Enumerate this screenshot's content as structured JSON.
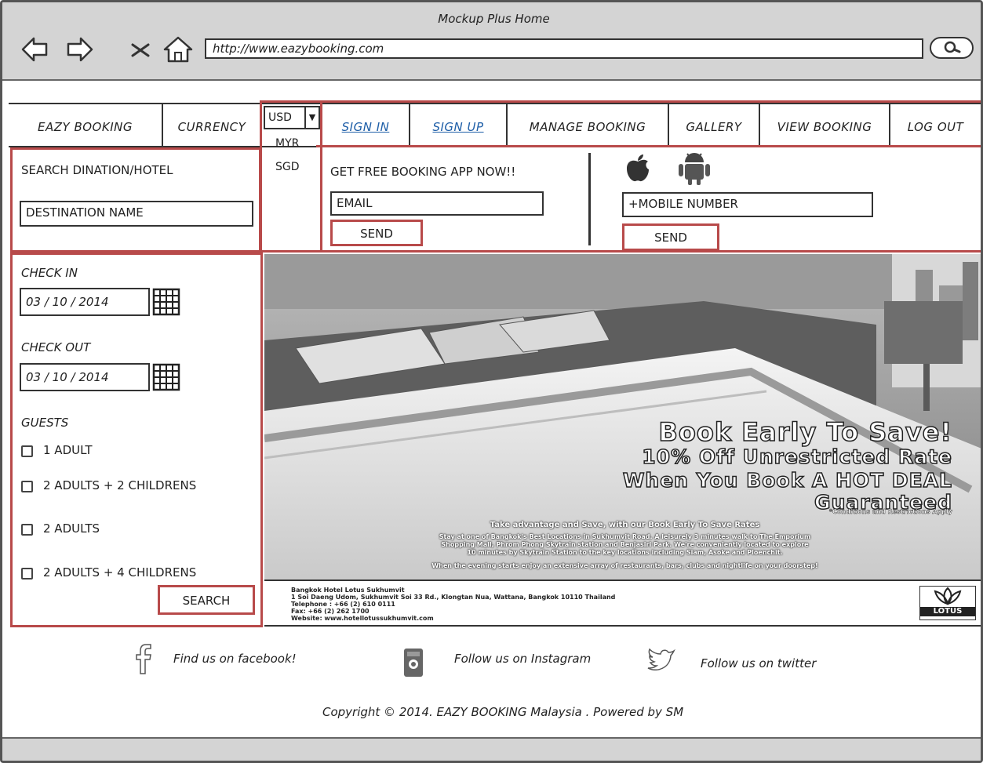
{
  "window": {
    "title": "Mockup Plus Home",
    "url": "http://www.eazybooking.com"
  },
  "nav": {
    "brand": "EAZY BOOKING",
    "currency_label": "CURRENCY",
    "currency_selected": "USD",
    "currency_options": [
      "MYR",
      "SGD"
    ],
    "sign_in": "SIGN IN",
    "sign_up": "SIGN UP",
    "manage_booking": "MANAGE BOOKING",
    "gallery": "GALLERY",
    "view_booking": "VIEW BOOKING",
    "log_out": "LOG OUT"
  },
  "search": {
    "title": "SEARCH DINATION/HOTEL",
    "destination_placeholder": "DESTINATION NAME",
    "check_in_label": "CHECK IN",
    "check_in_value": "03 / 10 / 2014",
    "check_out_label": "CHECK OUT",
    "check_out_value": "03 / 10 / 2014",
    "guests_label": "GUESTS",
    "guest_options": [
      "1 ADULT",
      "2 ADULTS + 2 CHILDRENS",
      "2 ADULTS",
      "2 ADULTS + 4 CHILDRENS"
    ],
    "search_button": "SEARCH"
  },
  "app_promo": {
    "title": "GET FREE BOOKING APP NOW!!",
    "email_placeholder": "EMAIL",
    "email_send": "SEND",
    "mobile_placeholder": "+MOBILE NUMBER",
    "mobile_send": "SEND"
  },
  "hero": {
    "line1": "Book Early To Save!",
    "line2": "10% Off Unrestricted Rate",
    "line3": "When You Book A HOT DEAL",
    "line4": "Guaranteed",
    "conditions": "*Conditions and Restrictions Apply",
    "subhead": "Take advantage and Save, with our Book Early To Save Rates",
    "body1": "Stay at one of Bangkok's Best Locations in Sukhumvit Road. A leisurely 3 minutes walk to The Emporium",
    "body2": "Shopping Mall, Phrom Phong Skytrain station and Benjasiri Park. We're conveniently located to explore",
    "body3": "10 minutes by Skytrain Station to the key locations including Siam, Asoke and Ploenchit.",
    "body4": "When the evening starts enjoy an extensive array of restaurants, bars, clubs and nightlife on your doorstep!",
    "contact_name": "Bangkok Hotel Lotus Sukhumvit",
    "contact_address": "1 Soi Daeng Udom, Sukhumvit Soi 33 Rd., Klongtan Nua, Wattana, Bangkok 10110 Thailand",
    "contact_tel": "Telephone : +66 (2) 610 0111",
    "contact_fax": "Fax: +66 (2) 262 1700",
    "contact_web": "Website: www.hotellotussukhumvit.com",
    "logo_text": "LOTUS"
  },
  "footer": {
    "facebook": "Find us on facebook!",
    "instagram": "Follow us on Instagram",
    "twitter": "Follow us on twitter",
    "copyright": "Copyright © 2014. EAZY BOOKING Malaysia . Powered by SM"
  },
  "colors": {
    "highlight_red": "#b84a4a",
    "link_blue": "#1f5fa8",
    "chrome_gray": "#d4d4d4"
  }
}
